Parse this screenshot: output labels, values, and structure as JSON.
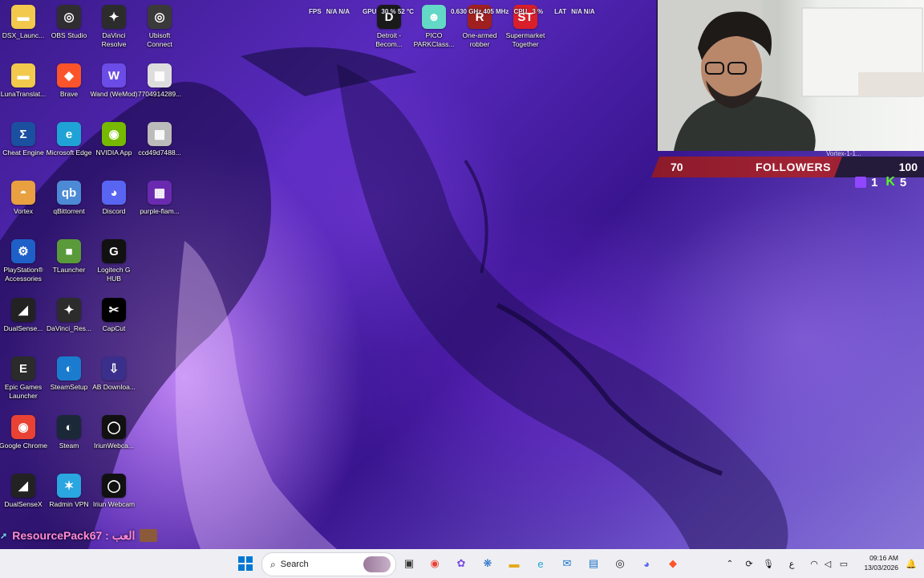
{
  "desktop": {
    "icons": [
      {
        "label": "DSX_Launc...",
        "icon": "folder-icon",
        "bg": "#f2c94c",
        "glyph": "▬"
      },
      {
        "label": "LunaTranslat...",
        "icon": "folder-icon",
        "bg": "#f2c94c",
        "glyph": "▬"
      },
      {
        "label": "Cheat Engine",
        "icon": "cheat-engine-icon",
        "bg": "#1b4fa0",
        "glyph": "Σ"
      },
      {
        "label": "Vortex",
        "icon": "vortex-icon",
        "bg": "#e8a040",
        "glyph": "◓"
      },
      {
        "label": "PlayStation® Accessories",
        "icon": "playstation-icon",
        "bg": "#1f5fc8",
        "glyph": "⚙"
      },
      {
        "label": "DualSense...",
        "icon": "dualsense-icon",
        "bg": "#222",
        "glyph": "◢"
      },
      {
        "label": "Epic Games Launcher",
        "icon": "epic-games-icon",
        "bg": "#2b2b2b",
        "glyph": "E"
      },
      {
        "label": "Google Chrome",
        "icon": "chrome-icon",
        "bg": "#e94235",
        "glyph": "◉"
      },
      {
        "label": "DualSenseX",
        "icon": "dualsensex-icon",
        "bg": "#222",
        "glyph": "◢"
      },
      {
        "label": "OBS Studio",
        "icon": "obs-icon",
        "bg": "#302e31",
        "glyph": "◎"
      },
      {
        "label": "Brave",
        "icon": "brave-icon",
        "bg": "#fb542b",
        "glyph": "◆"
      },
      {
        "label": "Microsoft Edge",
        "icon": "edge-icon",
        "bg": "#1fa3d6",
        "glyph": "e"
      },
      {
        "label": "qBittorrent",
        "icon": "qbittorrent-icon",
        "bg": "#4c8ad6",
        "glyph": "qb"
      },
      {
        "label": "TLauncher",
        "icon": "tlauncher-icon",
        "bg": "#5a9a3a",
        "glyph": "■"
      },
      {
        "label": "DaVinci_Res...",
        "icon": "davinci-icon",
        "bg": "#2c2c2c",
        "glyph": "✦"
      },
      {
        "label": "SteamSetup",
        "icon": "steam-setup-icon",
        "bg": "#1b7ccf",
        "glyph": "◐"
      },
      {
        "label": "Steam",
        "icon": "steam-icon",
        "bg": "#1b2838",
        "glyph": "◐"
      },
      {
        "label": "Radmin VPN",
        "icon": "radmin-icon",
        "bg": "#2aa6e0",
        "glyph": "✶"
      },
      {
        "label": "DaVinci Resolve",
        "icon": "davinci-resolve-icon",
        "bg": "#2c2c2c",
        "glyph": "✦"
      },
      {
        "label": "Wand (WeMod)",
        "icon": "wand-icon",
        "bg": "#6b4ce6",
        "glyph": "W"
      },
      {
        "label": "NVIDIA App",
        "icon": "nvidia-icon",
        "bg": "#76b900",
        "glyph": "◉"
      },
      {
        "label": "Discord",
        "icon": "discord-icon",
        "bg": "#5865f2",
        "glyph": "◕"
      },
      {
        "label": "Logitech G HUB",
        "icon": "logitech-icon",
        "bg": "#111",
        "glyph": "G"
      },
      {
        "label": "CapCut",
        "icon": "capcut-icon",
        "bg": "#000",
        "glyph": "✂"
      },
      {
        "label": "AB Downloa...",
        "icon": "ab-download-icon",
        "bg": "#3a2f8a",
        "glyph": "⇩"
      },
      {
        "label": "IriunWebca...",
        "icon": "iriun-icon",
        "bg": "#111",
        "glyph": "◯"
      },
      {
        "label": "Iriun Webcam",
        "icon": "iriun-webcam-icon",
        "bg": "#111",
        "glyph": "◯"
      },
      {
        "label": "Ubisoft Connect",
        "icon": "ubisoft-icon",
        "bg": "#3a3a3a",
        "glyph": "◎"
      },
      {
        "label": "7704914289...",
        "icon": "image-file-icon",
        "bg": "#ddd",
        "glyph": "▦"
      },
      {
        "label": "ccd49d7488...",
        "icon": "image-file-icon",
        "bg": "#bbb",
        "glyph": "▦"
      },
      {
        "label": "purple-flam...",
        "icon": "image-file-icon",
        "bg": "#6a2ab0",
        "glyph": "▦"
      },
      {
        "label": "Detroit - Becom...",
        "icon": "detroit-icon",
        "bg": "#1a1a1a",
        "glyph": "D"
      },
      {
        "label": "PICO PARKClass...",
        "icon": "pico-park-icon",
        "bg": "#64d8c6",
        "glyph": "☻"
      },
      {
        "label": "One-armed robber",
        "icon": "one-armed-robber-icon",
        "bg": "#a02020",
        "glyph": "R"
      },
      {
        "label": "Supermarket Together",
        "icon": "supermarket-icon",
        "bg": "#d81f2a",
        "glyph": "ST"
      }
    ]
  },
  "perf_overlay": {
    "fps_label": "FPS",
    "fps_value": "N/A N/A",
    "gpu_label": "GPU",
    "gpu_value": "30 % 52 °C",
    "mem_value": "0.630 GHz 405 MHz",
    "cpu_label": "CPU",
    "cpu_value": "3 %",
    "lat_label": "LAT",
    "lat_value": "N/A N/A"
  },
  "stream": {
    "webcam_caption": "Vortex-1-1...",
    "followers_count": "70",
    "followers_title": "FOLLOWERS",
    "followers_goal": "100",
    "twitch_count": "1",
    "kick_count": "5",
    "ticker_text": "ResourcePack67 : العب"
  },
  "taskbar": {
    "search_placeholder": "Search",
    "time": "09:16 AM",
    "date": "13/03/2026",
    "language": "ع",
    "colors": {
      "bg": "#efeff3",
      "accent": "#0078d4"
    }
  }
}
